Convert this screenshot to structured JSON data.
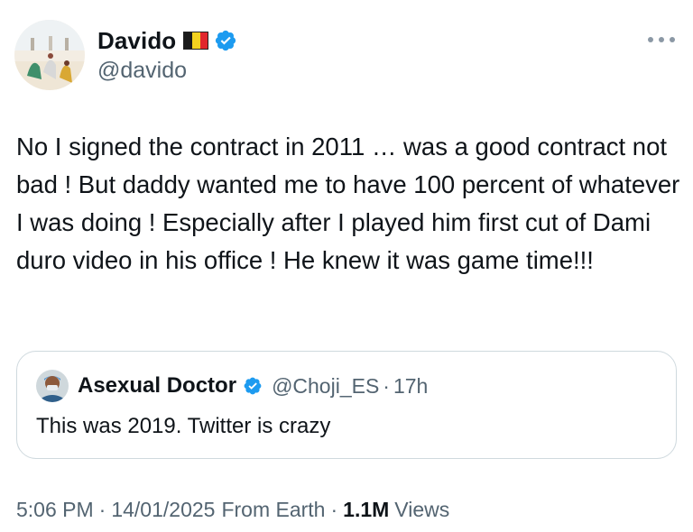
{
  "author": {
    "display_name": "Davido",
    "handle": "@davido",
    "flag_icon": "belgium-flag-icon",
    "verified_icon": "verified-badge-icon",
    "verified_color": "#1d9bf0"
  },
  "more_icon": "more-options-icon",
  "tweet": {
    "text": "No I signed the contract in 2011 … was a good contract not bad ! But daddy wanted me to have 100 percent of whatever I was doing ! Especially after I played him first cut of Dami duro video in his office ! He knew it was game time!!!"
  },
  "quote": {
    "display_name": "Asexual Doctor",
    "handle": "@Choji_ES",
    "separator": "·",
    "time": "17h",
    "text": "This was 2019. Twitter is crazy"
  },
  "meta": {
    "time": "5:06 PM",
    "sep1": "·",
    "date": "14/01/2025",
    "source": "From Earth",
    "sep2": "·",
    "views_count": "1.1M",
    "views_label": "Views"
  }
}
